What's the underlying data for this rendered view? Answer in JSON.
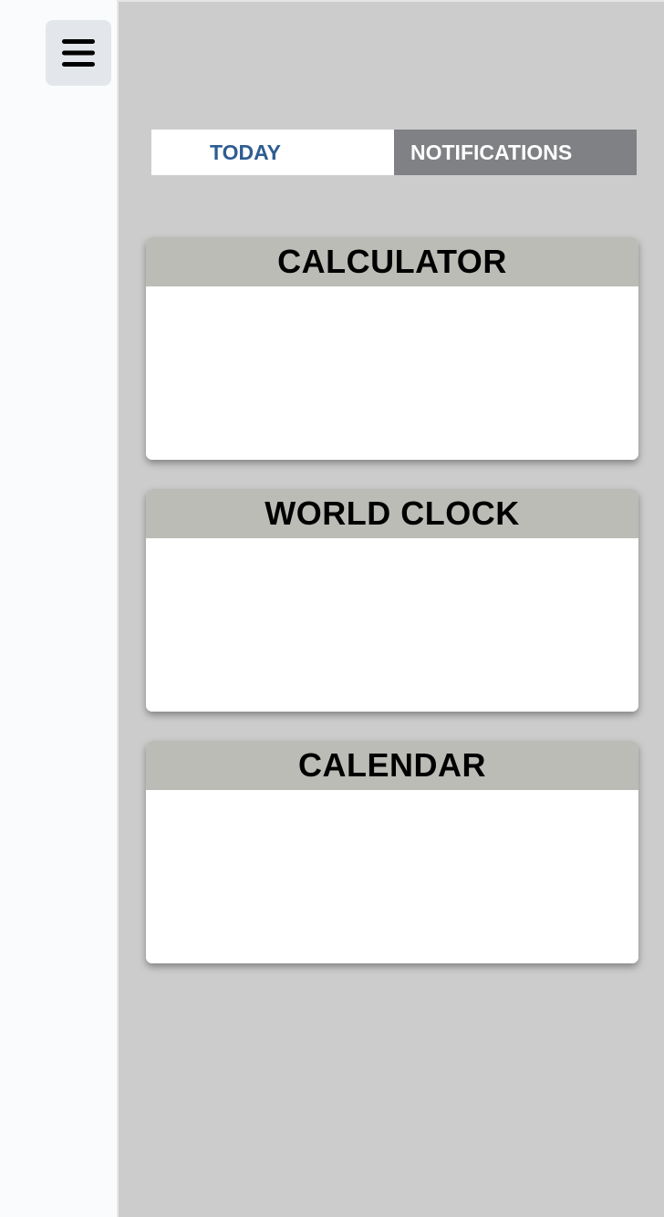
{
  "menu": {
    "icon": "hamburger-menu-icon"
  },
  "tabs": [
    {
      "label": "TODAY",
      "selected": true
    },
    {
      "label": "NOTIFICATIONS",
      "selected": false
    }
  ],
  "widgets": [
    {
      "title": "CALCULATOR"
    },
    {
      "title": "WORLD CLOCK"
    },
    {
      "title": "CALENDAR"
    }
  ],
  "colors": {
    "panel_bg": "#cccccc",
    "tab_active_text": "#2e5d92",
    "tab_inactive_bg": "#808185",
    "card_header_bg": "#bcbcb7"
  }
}
